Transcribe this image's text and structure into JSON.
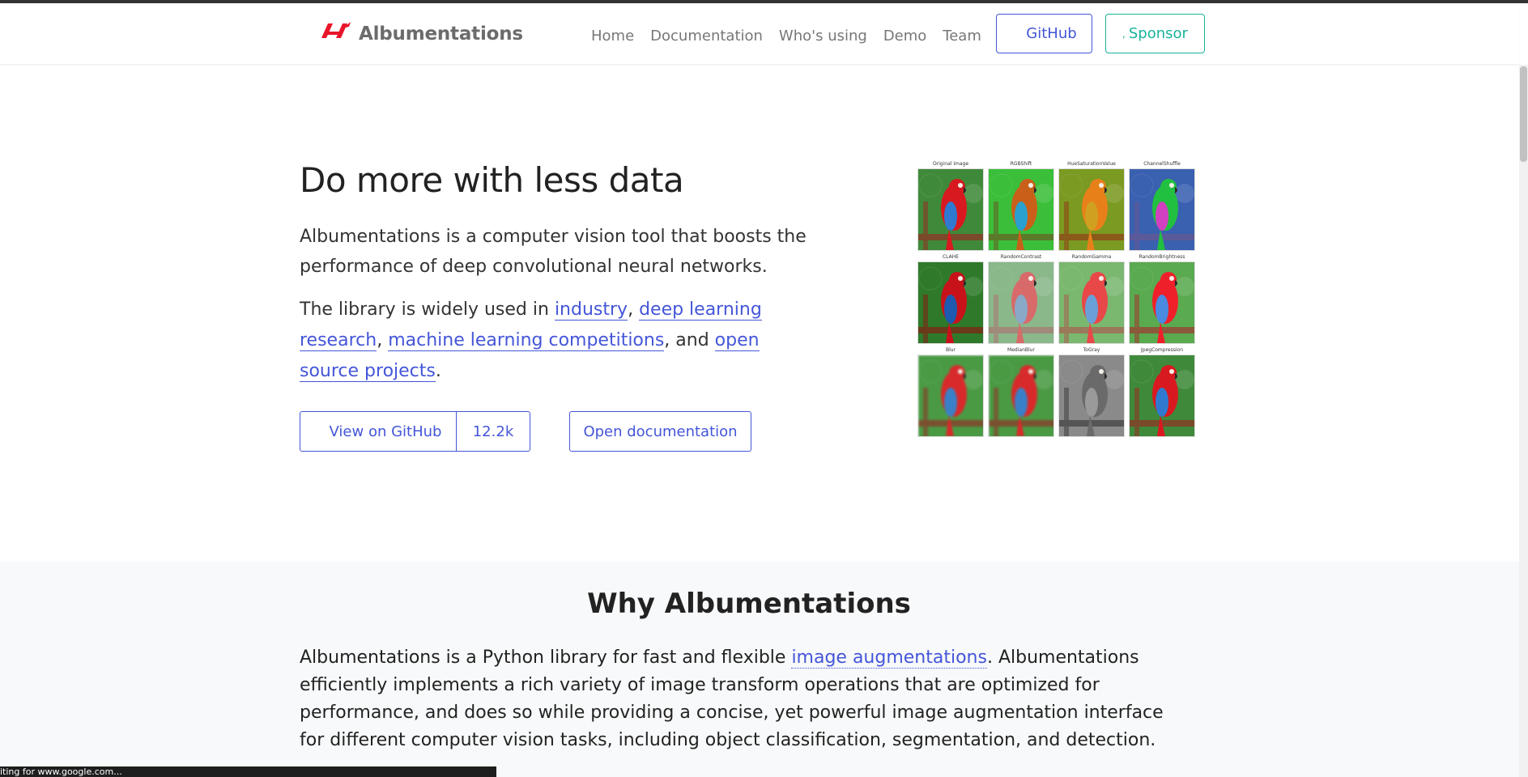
{
  "header": {
    "brand": "Albumentations",
    "nav": [
      "Home",
      "Documentation",
      "Who's using",
      "Demo",
      "Team"
    ],
    "github_label": "GitHub",
    "sponsor_label": "Sponsor",
    "sponsor_prefix": ",",
    "brand_color": "#e8162b"
  },
  "hero": {
    "title": "Do more with less data",
    "intro": "Albumentations is a computer vision tool that boosts the performance of deep convolutional neural networks.",
    "usage_prefix": "The library is widely used in ",
    "links": [
      "industry",
      "deep learning research",
      "machine learning competitions",
      "open source projects"
    ],
    "sep1": ", ",
    "sep2": ", ",
    "sep3": ", and ",
    "usage_suffix": ".",
    "view_github_label": "View on GitHub",
    "stars": "12.2k",
    "open_docs_label": "Open documentation",
    "accent_color": "#4456d8"
  },
  "augmentations": [
    {
      "caption": "Original image",
      "tint": "none"
    },
    {
      "caption": "RGBShift",
      "tint": "green"
    },
    {
      "caption": "HueSaturationValue",
      "tint": "orange"
    },
    {
      "caption": "ChannelShuffle",
      "tint": "cyan"
    },
    {
      "caption": "CLAHE",
      "tint": "contrast"
    },
    {
      "caption": "RandomContrast",
      "tint": "faded"
    },
    {
      "caption": "RandomGamma",
      "tint": "light"
    },
    {
      "caption": "RandomBrightness",
      "tint": "bright"
    },
    {
      "caption": "Blur",
      "tint": "blur"
    },
    {
      "caption": "MedianBlur",
      "tint": "blur"
    },
    {
      "caption": "ToGray",
      "tint": "gray"
    },
    {
      "caption": "JpegCompression",
      "tint": "none"
    }
  ],
  "why": {
    "title": "Why Albumentations",
    "prefix": "Albumentations is a Python library for fast and flexible ",
    "link": "image augmentations",
    "suffix": ". Albumentations efficiently implements a rich variety of image transform operations that are optimized for performance, and does so while providing a concise, yet powerful image augmentation interface for different computer vision tasks, including object classification, segmentation, and detection."
  },
  "status_text": "iting for www.google.com..."
}
